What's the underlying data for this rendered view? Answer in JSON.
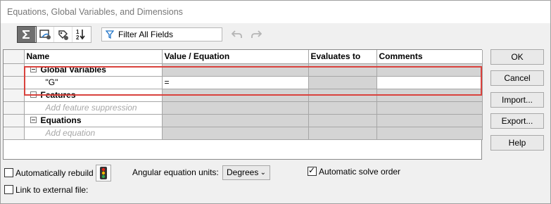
{
  "window": {
    "title": "Equations, Global Variables, and Dimensions"
  },
  "toolbar": {
    "buttons": [
      "equation-view-icon",
      "sketch-equation-view-icon",
      "dimension-view-icon",
      "ordered-view-icon"
    ],
    "filter_placeholder": "Filter All Fields"
  },
  "grid": {
    "columns": [
      "Name",
      "Value / Equation",
      "Evaluates to",
      "Comments"
    ],
    "global_variables": {
      "header": "Global Variables",
      "row": {
        "name": "\"G\"",
        "value": "=",
        "evaluates": "",
        "comments": ""
      }
    },
    "features": {
      "header": "Features",
      "placeholder": "Add feature suppression"
    },
    "equations": {
      "header": "Equations",
      "placeholder": "Add equation"
    }
  },
  "buttons": {
    "ok": "OK",
    "cancel": "Cancel",
    "import": "Import...",
    "export": "Export...",
    "help": "Help"
  },
  "options": {
    "auto_rebuild": {
      "label": "Automatically rebuild",
      "checked": false
    },
    "link_external": {
      "label": "Link to external file:",
      "checked": false
    },
    "angular_units_label": "Angular equation units:",
    "angular_units_value": "Degrees",
    "auto_solve": {
      "label": "Automatic solve order",
      "checked": true
    }
  },
  "colors": {
    "highlight": "#d9423d",
    "cell_gray": "#d4d4d4"
  }
}
